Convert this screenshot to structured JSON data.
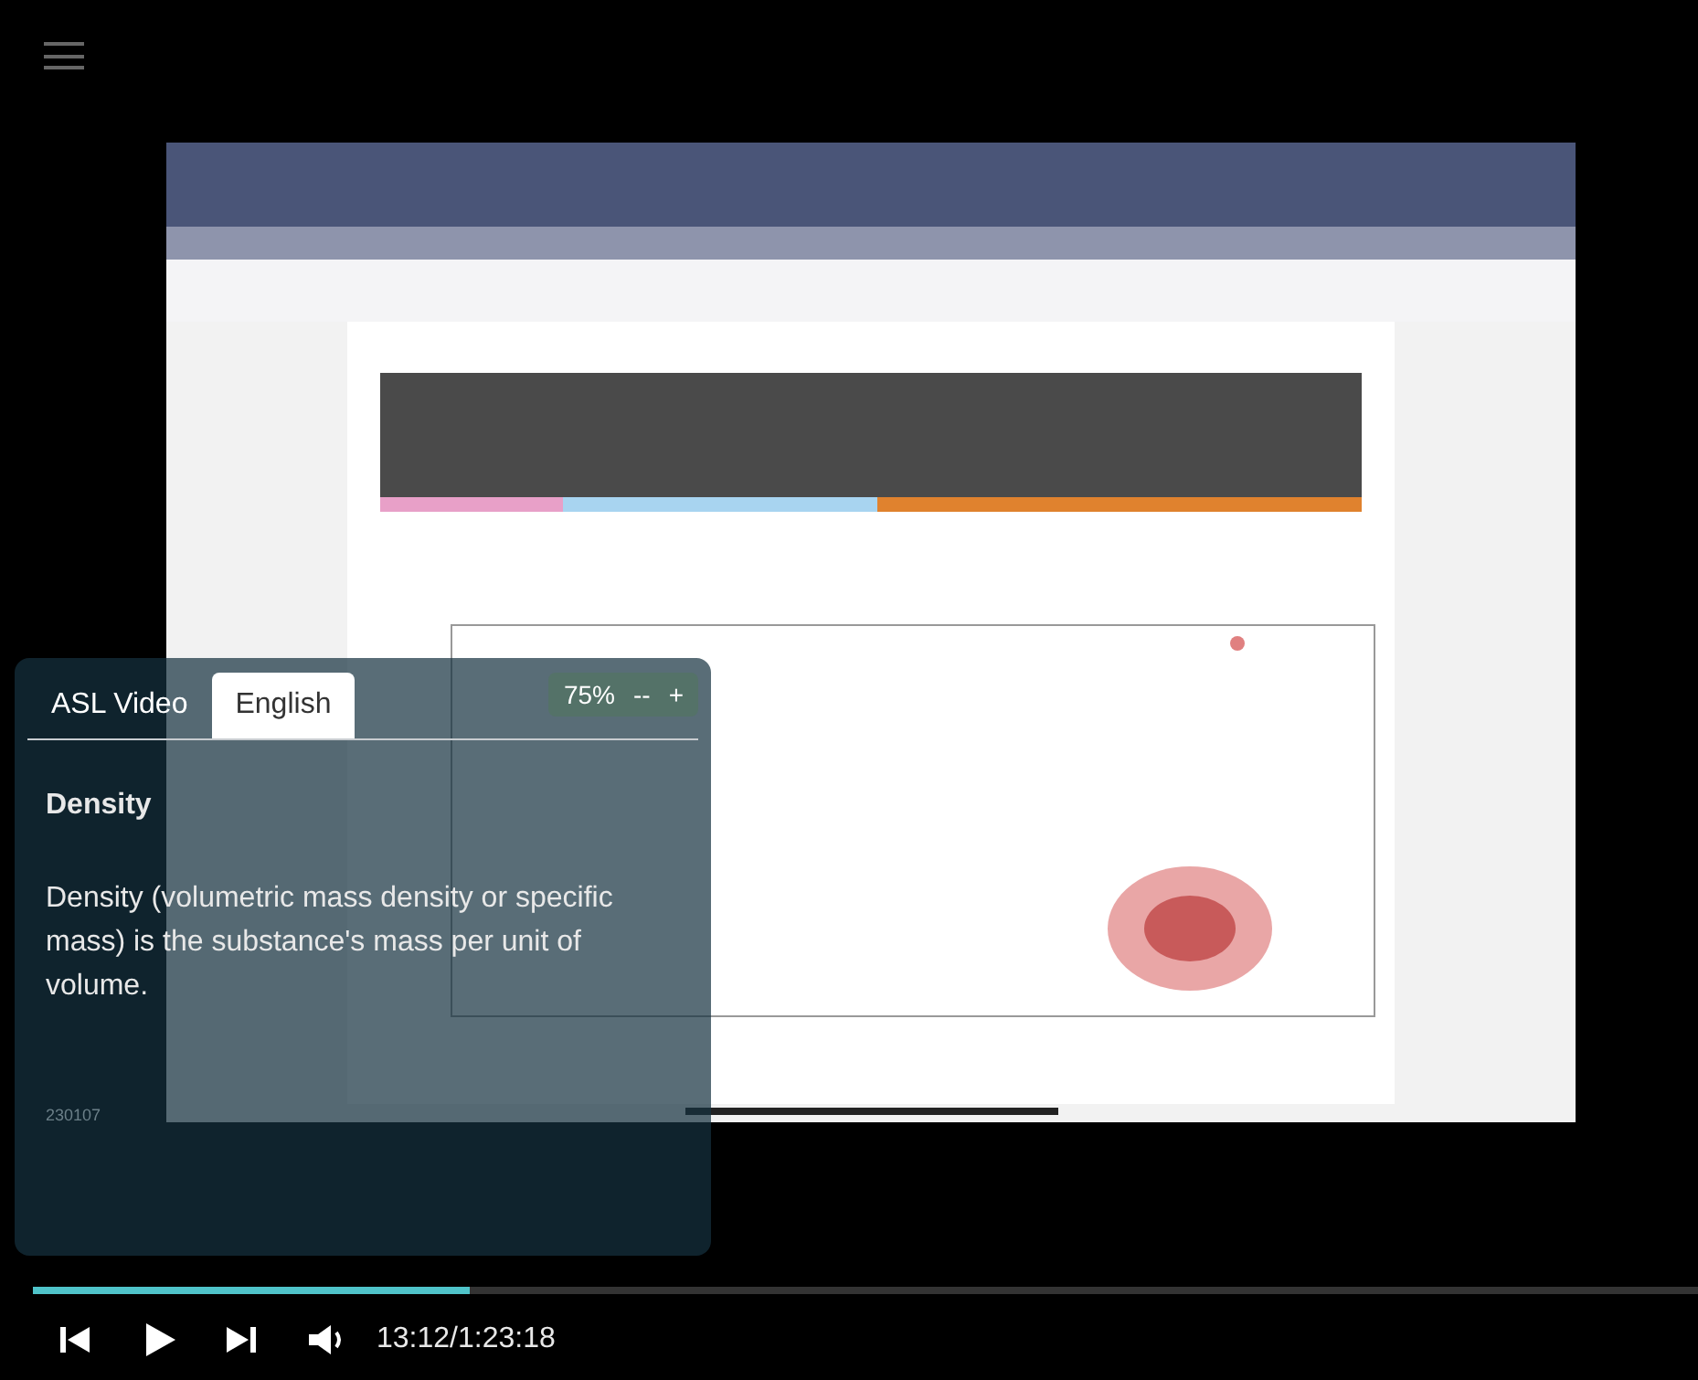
{
  "caption_panel": {
    "tabs": [
      {
        "label": "ASL Video",
        "selected": false
      },
      {
        "label": "English",
        "selected": true
      }
    ],
    "zoom": {
      "value": "75%",
      "decrease": "--",
      "increase": "+"
    },
    "heading": "Density",
    "body": "Density (volumetric mass density or specific mass) is the substance's mass per unit of volume.",
    "code": "230107"
  },
  "player": {
    "progress": {
      "level": 0.262
    },
    "time": "13:12/1:23:18"
  }
}
